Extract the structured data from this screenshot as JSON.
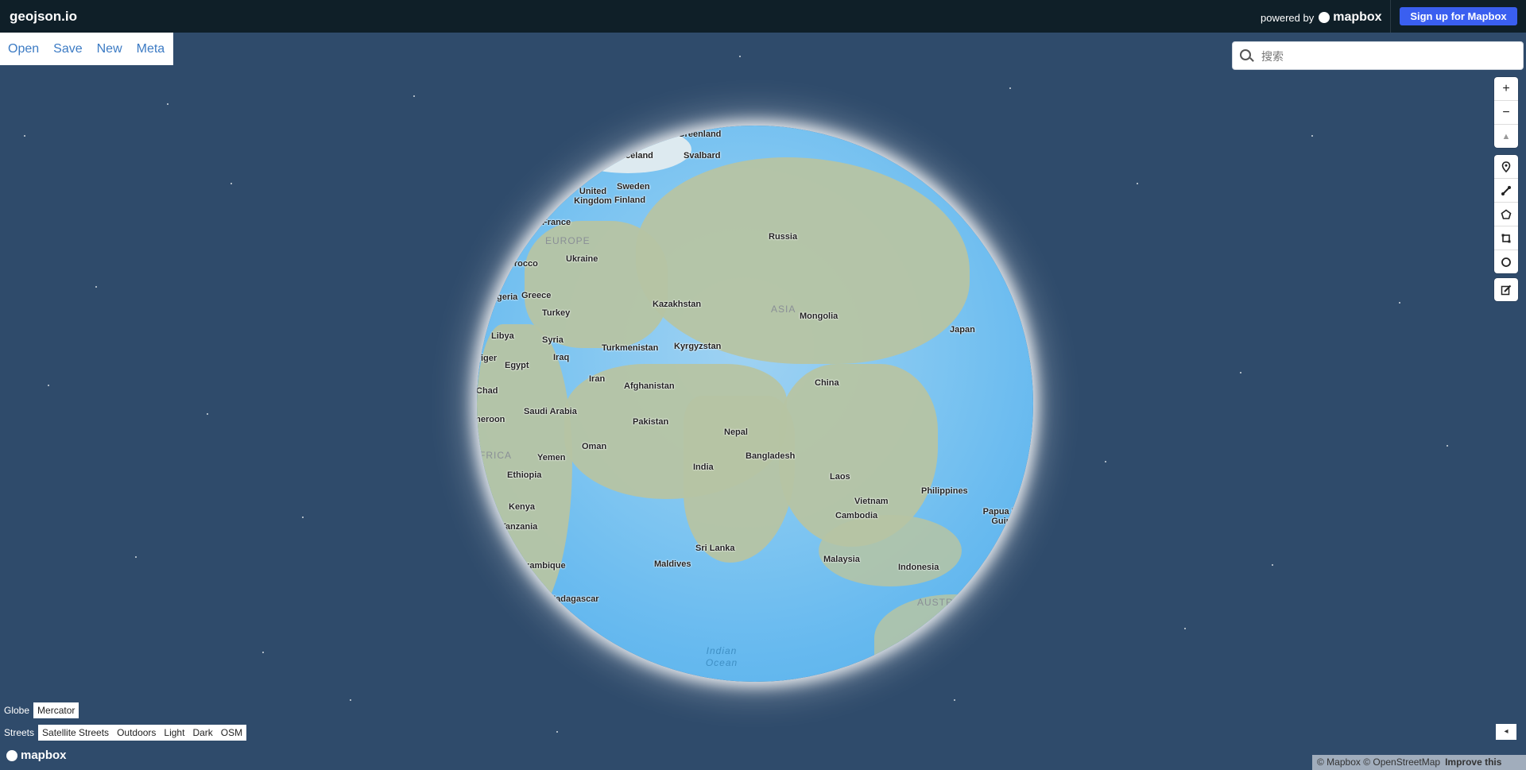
{
  "header": {
    "brand": "geojson.io",
    "powered_by": "powered by",
    "mapbox_logo": "mapbox",
    "signup_label": "Sign up for Mapbox"
  },
  "file_menu": {
    "open": "Open",
    "save": "Save",
    "new": "New",
    "meta": "Meta"
  },
  "search": {
    "placeholder": "搜索",
    "icon": "search-icon"
  },
  "map_controls": {
    "zoom_in": "+",
    "zoom_out": "−",
    "compass": "▲",
    "draw_tools": [
      "marker-icon",
      "line-icon",
      "polygon-icon",
      "rectangle-icon",
      "circle-icon"
    ],
    "edit": "edit-icon"
  },
  "map_labels": {
    "countries": [
      "Greenland",
      "Iceland",
      "Svalbard",
      "United Kingdom",
      "Sweden",
      "Finland",
      "France",
      "Ukraine",
      "Morocco",
      "Algeria",
      "Greece",
      "Turkey",
      "Libya",
      "Syria",
      "Iraq",
      "Niger",
      "Egypt",
      "Chad",
      "Cameroon",
      "Saudi Arabia",
      "Yemen",
      "Oman",
      "Ethiopia",
      "Kenya",
      "Tanzania",
      "Mozambique",
      "Madagascar",
      "Russia",
      "Kazakhstan",
      "Mongolia",
      "Japan",
      "Turkmenistan",
      "Kyrgyzstan",
      "Iran",
      "Afghanistan",
      "Pakistan",
      "China",
      "Nepal",
      "Bangladesh",
      "India",
      "Laos",
      "Vietnam",
      "Philippines",
      "Cambodia",
      "Sri Lanka",
      "Maldives",
      "Malaysia",
      "Indonesia",
      "Papua New Guinea"
    ],
    "regions": [
      "EUROPE",
      "ASIA",
      "AFRICA",
      "AUSTRALIA"
    ],
    "ocean": [
      "Indian",
      "Ocean"
    ]
  },
  "projection": {
    "label": "Globe",
    "option": "Mercator"
  },
  "styles": {
    "label": "Streets",
    "options": [
      "Satellite Streets",
      "Outdoors",
      "Light",
      "Dark",
      "OSM"
    ]
  },
  "footer": {
    "mapbox_logo": "mapbox",
    "attribution": "© Mapbox © OpenStreetMap",
    "improve": "Improve this map",
    "collapse": "◂"
  }
}
